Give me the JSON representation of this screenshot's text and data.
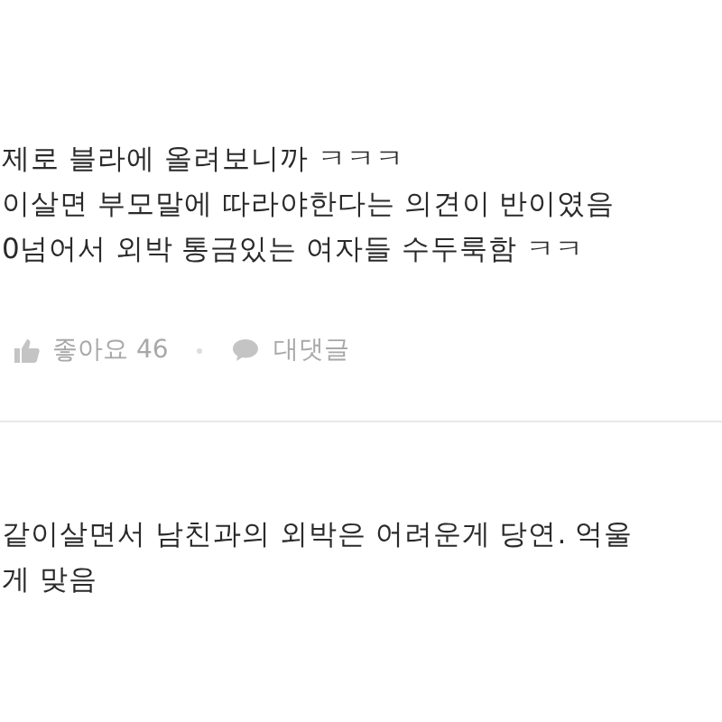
{
  "comments": [
    {
      "lines": [
        "제로 블라에 올려보니까 ㅋㅋㅋ",
        "이살면 부모말에 따라야한다는 의견이 반이였음",
        "0넘어서 외박 통금있는 여자들 수두룩함 ㅋㅋ"
      ],
      "like_label": "좋아요 46",
      "reply_label": "대댓글"
    },
    {
      "lines": [
        "같이살면서 남친과의 외박은 어려운게 당연. 억울",
        "게 맞음"
      ]
    }
  ]
}
